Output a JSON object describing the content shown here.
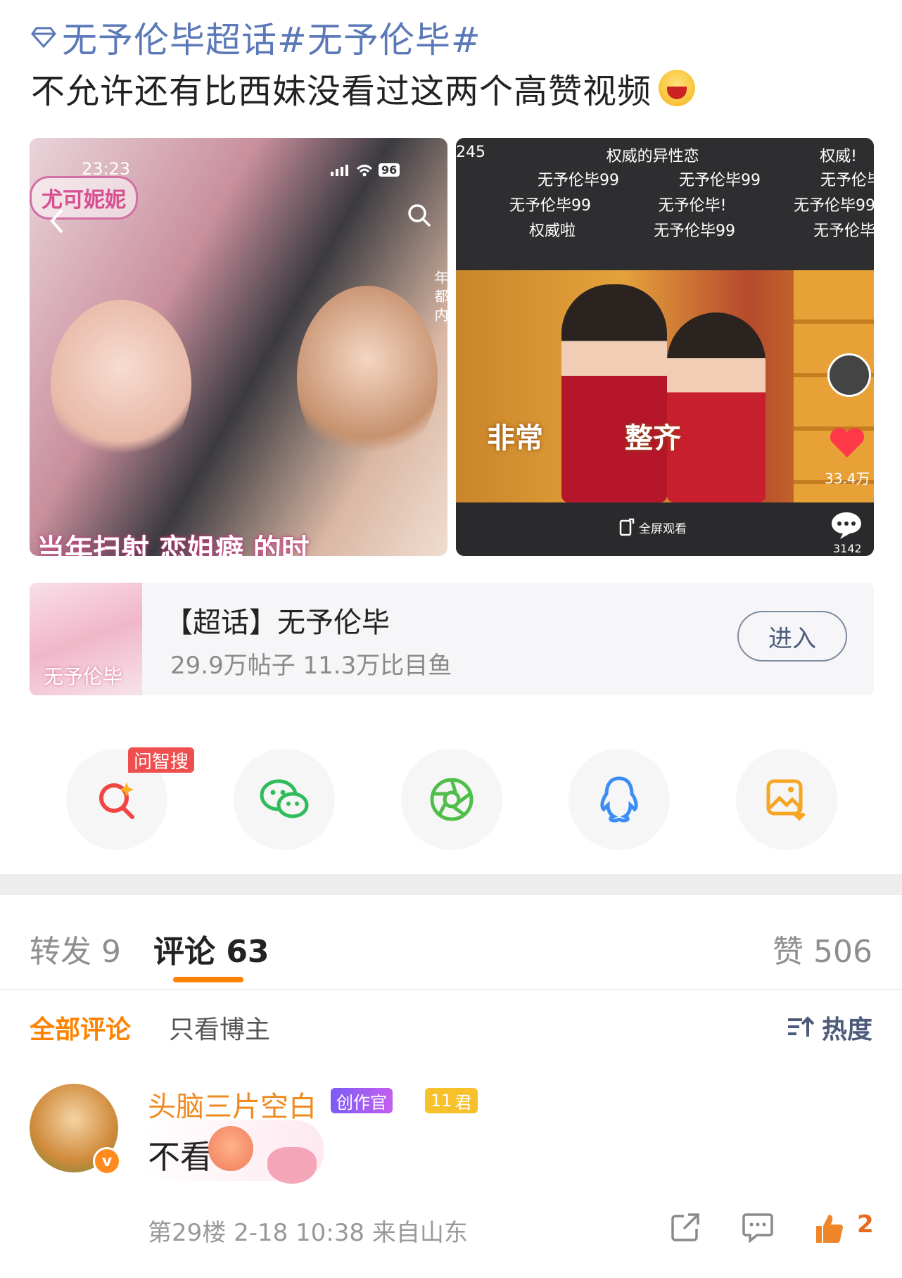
{
  "post": {
    "topic": "无予伦毕超话#无予伦毕#",
    "text": "不允许还有比西妹没看过这两个高赞视频"
  },
  "media": {
    "left": {
      "time": "23:23",
      "battery": "96",
      "user_badge": "尤可妮妮",
      "side_text": "年 都 内",
      "caption": "当年扫射 恋姐癖 的时"
    },
    "right": {
      "danmaku_row1": [
        "245",
        "权威的异性恋",
        "权威!"
      ],
      "danmaku_row2": [
        "无予伦毕99",
        "无予伦毕99",
        "无予伦毕"
      ],
      "danmaku_row3": [
        "无予伦毕99",
        "无予伦毕!",
        "无予伦毕99"
      ],
      "danmaku_row4": [
        "权威啦",
        "无予伦毕99",
        "无予伦毕"
      ],
      "caption_left": "非常",
      "caption_right": "整齐",
      "like_count": "33.4万",
      "fullscreen_label": "全屏观看",
      "comment_count": "3142"
    }
  },
  "chaohua_card": {
    "title": "【超话】无予伦毕",
    "stats": "29.9万帖子 11.3万比目鱼",
    "thumb_text": "无予伦毕",
    "enter_label": "进入"
  },
  "share": {
    "ai_tag": "问智搜",
    "items": [
      "search-ai-icon",
      "wechat-icon",
      "moments-icon",
      "qq-icon",
      "save-image-icon"
    ]
  },
  "tabs": {
    "repost": "转发 9",
    "comment": "评论 63",
    "like": "赞 506"
  },
  "filters": {
    "all": "全部评论",
    "owner_only": "只看博主",
    "sort": "热度"
  },
  "comment": {
    "username": "头脑三片空白",
    "creator_badge": "创作官",
    "level_badge": "君",
    "level_num": "11",
    "text": "不看",
    "meta": "第29楼  2-18 10:38 来自山东",
    "like_count": "2"
  },
  "colors": {
    "accent": "#ff8200",
    "topic_blue": "#5b79b8",
    "username_orange": "#f08a22"
  }
}
